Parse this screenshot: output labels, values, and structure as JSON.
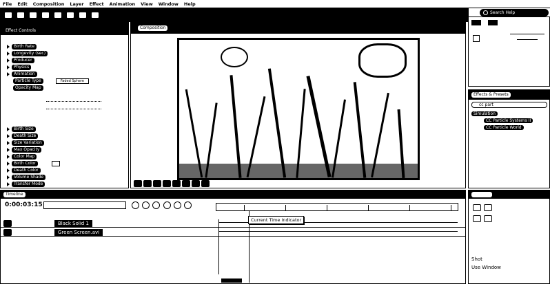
{
  "menu": [
    "File",
    "Edit",
    "Composition",
    "Layer",
    "Effect",
    "Animation",
    "View",
    "Window",
    "Help"
  ],
  "search": {
    "placeholder": "Search Help"
  },
  "effects_panel": {
    "tab": "Effect Controls",
    "rows_top": [
      "Birth Rate",
      "Longevity (sec)",
      "Producer",
      "Physics",
      "Animation",
      "Particle Type",
      "Opacity Map"
    ],
    "value_type": "Faded Sphere",
    "rows_bottom": [
      "Birth Size",
      "Death Size",
      "Size Variation",
      "Max Opacity",
      "Color Map",
      "Birth Color",
      "Death Color",
      "Volume Shade",
      "Transfer Mode"
    ]
  },
  "comp_panel": {
    "tab": "Composition"
  },
  "effects_presets": {
    "tab": "Effects & Presets",
    "search_value": "cc part",
    "category": "Simulation",
    "items": [
      "CC Particle Systems II",
      "CC Particle World"
    ]
  },
  "timeline": {
    "tab": "Timeline",
    "timecode": "0:00:03:15",
    "layers": [
      "Black Solid 1",
      "Green Screen.avi"
    ]
  },
  "tooltip": "Current Time Indicator",
  "right_bottom": {
    "line1": "Shot",
    "line2": "Use Window"
  }
}
